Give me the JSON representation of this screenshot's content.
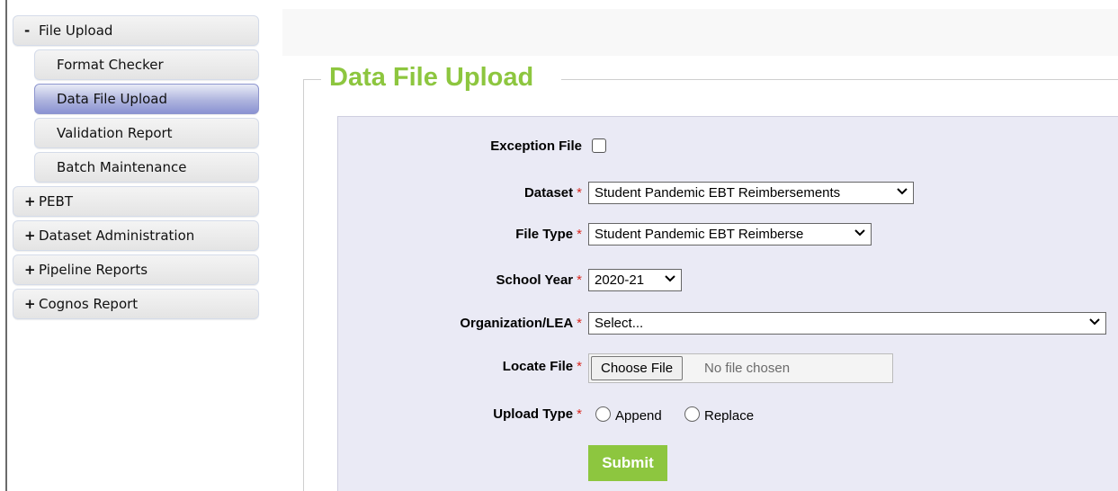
{
  "sidebar": {
    "file_upload": {
      "sign": "-",
      "label": "File Upload"
    },
    "sub_items": [
      {
        "label": "Format Checker"
      },
      {
        "label": "Data File Upload"
      },
      {
        "label": "Validation Report"
      },
      {
        "label": "Batch Maintenance"
      }
    ],
    "collapsed_items": [
      {
        "sign": "+",
        "label": "PEBT"
      },
      {
        "sign": "+",
        "label": "Dataset Administration"
      },
      {
        "sign": "+",
        "label": "Pipeline Reports"
      },
      {
        "sign": "+",
        "label": "Cognos Report"
      }
    ]
  },
  "main": {
    "title": "Data File Upload",
    "required_mark": "*",
    "fields": {
      "exception_file": {
        "label": "Exception File"
      },
      "dataset": {
        "label": "Dataset",
        "value": "Student Pandemic EBT Reimbersements"
      },
      "file_type": {
        "label": "File Type",
        "value": "Student Pandemic EBT Reimberse"
      },
      "school_year": {
        "label": "School Year",
        "value": "2020-21"
      },
      "organization": {
        "label": "Organization/LEA",
        "value": "Select..."
      },
      "locate_file": {
        "label": "Locate File",
        "button": "Choose File",
        "status": "No file chosen"
      },
      "upload_type": {
        "label": "Upload Type",
        "options": [
          "Append",
          "Replace"
        ]
      }
    },
    "submit_label": "Submit"
  },
  "icons": {
    "dropdown": "chevron-down-icon"
  },
  "colors": {
    "accent": "#8dc63f",
    "required": "#d9251c",
    "active_menu": "#aeb4de",
    "panel": "#eaeaf5"
  }
}
